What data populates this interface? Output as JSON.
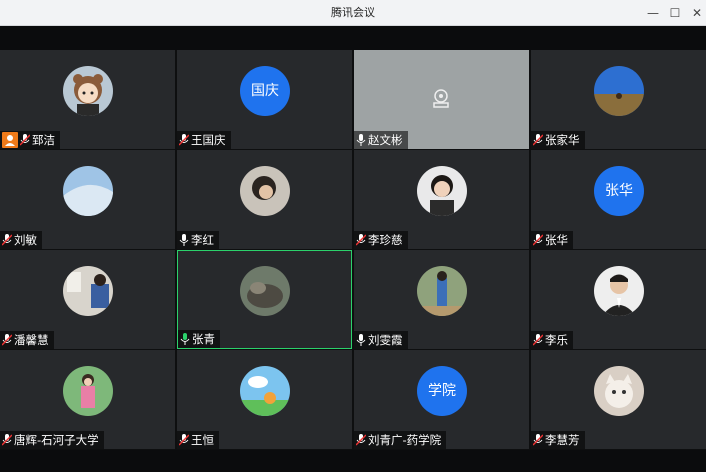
{
  "window": {
    "title": "腾讯会议",
    "minimize": "—",
    "maximize": "☐",
    "close": "✕"
  },
  "participants": [
    {
      "name": "郅洁",
      "avatar": "cartoon",
      "mic": "muted",
      "host": true
    },
    {
      "name": "王国庆",
      "avatar_text": "国庆",
      "mic": "muted"
    },
    {
      "name": "赵文彬",
      "avatar": "camera-sharing",
      "mic": "on"
    },
    {
      "name": "张家华",
      "avatar": "photo-landscape",
      "mic": "muted"
    },
    {
      "name": "刘敏",
      "avatar": "photo-sky",
      "mic": "muted"
    },
    {
      "name": "李红",
      "avatar": "photo-person-dark",
      "mic": "on"
    },
    {
      "name": "李珍慈",
      "avatar": "photo-woman",
      "mic": "muted"
    },
    {
      "name": "张华",
      "avatar_text": "张华",
      "mic": "muted"
    },
    {
      "name": "潘馨慧",
      "avatar": "photo-room",
      "mic": "muted"
    },
    {
      "name": "张青",
      "avatar": "photo-rocks",
      "mic": "on",
      "speaking": true
    },
    {
      "name": "刘雯霞",
      "avatar": "photo-outdoor",
      "mic": "on"
    },
    {
      "name": "李乐",
      "avatar": "photo-man-suit",
      "mic": "muted"
    },
    {
      "name": "唐辉-石河子大学",
      "avatar": "photo-woman-pink",
      "mic": "muted"
    },
    {
      "name": "王恒",
      "avatar": "photo-cartoon-sky",
      "mic": "muted"
    },
    {
      "name": "刘青广-药学院",
      "avatar_text": "学院",
      "mic": "muted"
    },
    {
      "name": "李慧芳",
      "avatar": "photo-cat",
      "mic": "muted"
    }
  ],
  "colors": {
    "avatar_text_bg": "#1f73ee",
    "speaking_border": "#2bd16b",
    "host_badge": "#f07b1a",
    "tile_bg": "#27292c",
    "sharing_tile_bg": "#9ea3a4"
  }
}
